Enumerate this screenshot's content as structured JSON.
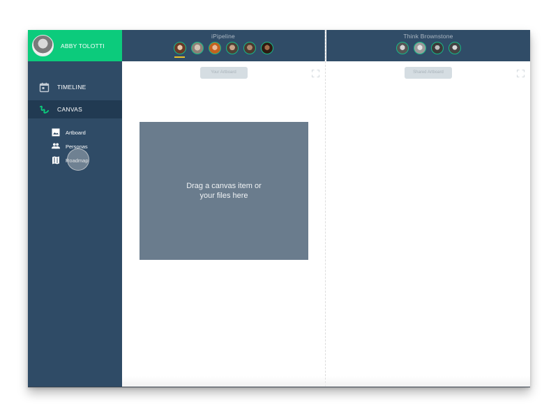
{
  "user": {
    "name": "ABBY TOLOTTI",
    "avatar_icon": "user-avatar-photo"
  },
  "sidebar": {
    "nav": [
      {
        "label": "TIMELINE",
        "icon": "calendar-icon",
        "active": false
      },
      {
        "label": "CANVAS",
        "icon": "squiggle-icon",
        "active": true
      }
    ],
    "sub_items": [
      {
        "label": "Artboard",
        "icon": "image-icon"
      },
      {
        "label": "Personas",
        "icon": "people-icon"
      },
      {
        "label": "Roadmap",
        "icon": "map-icon"
      }
    ]
  },
  "columns": [
    {
      "title": "iPipeline",
      "members": [
        {
          "name": "member-1",
          "color": "#7a4a38",
          "selected": true
        },
        {
          "name": "member-2",
          "color": "#a89c92",
          "selected": false
        },
        {
          "name": "member-3",
          "color": "#c3703c",
          "selected": false
        },
        {
          "name": "member-4",
          "color": "#6b5a4e",
          "selected": false
        },
        {
          "name": "member-5",
          "color": "#5e4a40",
          "selected": false
        },
        {
          "name": "member-6",
          "color": "#4a2e22",
          "selected": false
        }
      ],
      "artboard_label": "Your Artboard",
      "drop_zone_text": "Drag a canvas item or your files here"
    },
    {
      "title": "Think Brownstone",
      "members": [
        {
          "name": "member-1",
          "color": "#8d8d8d",
          "selected": false
        },
        {
          "name": "member-2",
          "color": "#b8b8b8",
          "selected": false
        },
        {
          "name": "member-3",
          "color": "#5e5e5e",
          "selected": false
        },
        {
          "name": "member-4",
          "color": "#9a9a9a",
          "selected": false
        }
      ],
      "artboard_label": "Shared Artboard"
    }
  ],
  "colors": {
    "accent_green": "#0ccb7c",
    "sidebar_bg": "#2f4b66",
    "header_bg": "#304c67",
    "active_nav_bg": "#213a52",
    "drop_zone_bg": "#6a7c8d",
    "selected_indicator": "#e8c12a"
  }
}
